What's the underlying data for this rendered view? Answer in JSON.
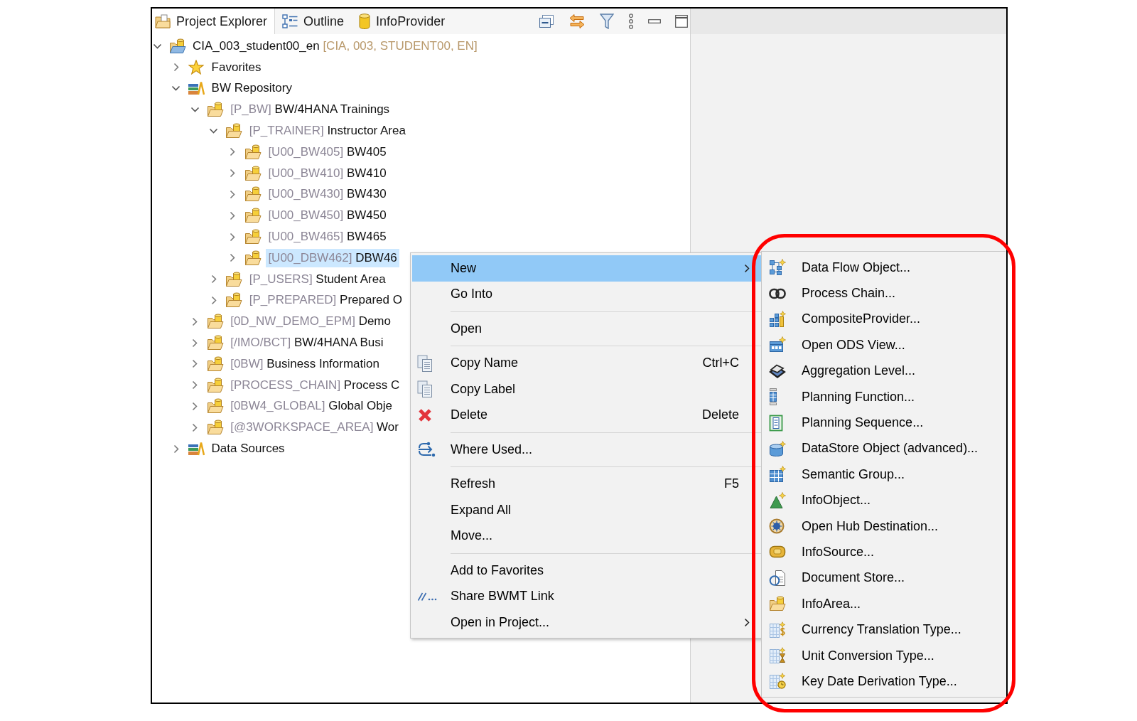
{
  "explorer": {
    "tabs": [
      {
        "kind": "explorer",
        "label": "Project Explorer",
        "selected": true
      },
      {
        "kind": "outline",
        "label": "Outline",
        "selected": false
      },
      {
        "kind": "provider",
        "label": "InfoProvider",
        "selected": false
      }
    ],
    "tree": [
      {
        "kind": "project",
        "name": "CIA_003_student00_en",
        "details": "[CIA, 003, STUDENT00, EN]",
        "expanded": true,
        "selected": false,
        "children": [
          {
            "kind": "favorites",
            "name": "Favorites",
            "expanded": false,
            "selected": false
          },
          {
            "kind": "repository",
            "name": "BW Repository",
            "expanded": true,
            "selected": false,
            "children": [
              {
                "kind": "infoarea",
                "tech_name": "[P_BW]",
                "name": "BW/4HANA Trainings",
                "expanded": true,
                "selected": false,
                "children": [
                  {
                    "kind": "infoarea",
                    "tech_name": "[P_TRAINER]",
                    "name": "Instructor Area",
                    "expanded": true,
                    "selected": false,
                    "children": [
                      {
                        "kind": "infoarea",
                        "tech_name": "[U00_BW405]",
                        "name": "BW405",
                        "expanded": false,
                        "selected": false
                      },
                      {
                        "kind": "infoarea",
                        "tech_name": "[U00_BW410]",
                        "name": "BW410",
                        "expanded": false,
                        "selected": false
                      },
                      {
                        "kind": "infoarea",
                        "tech_name": "[U00_BW430]",
                        "name": "BW430",
                        "expanded": false,
                        "selected": false
                      },
                      {
                        "kind": "infoarea",
                        "tech_name": "[U00_BW450]",
                        "name": "BW450",
                        "expanded": false,
                        "selected": false
                      },
                      {
                        "kind": "infoarea",
                        "tech_name": "[U00_BW465]",
                        "name": "BW465",
                        "expanded": false,
                        "selected": false
                      },
                      {
                        "kind": "infoarea",
                        "tech_name": "[U00_DBW462]",
                        "name": "DBW46",
                        "expanded": false,
                        "selected": true
                      }
                    ]
                  },
                  {
                    "kind": "infoarea",
                    "tech_name": "[P_USERS]",
                    "name": "Student Area",
                    "expanded": false,
                    "selected": false
                  },
                  {
                    "kind": "infoarea",
                    "tech_name": "[P_PREPARED]",
                    "name": "Prepared O",
                    "expanded": false,
                    "selected": false
                  }
                ]
              },
              {
                "kind": "infoarea",
                "tech_name": "[0D_NW_DEMO_EPM]",
                "name": "Demo",
                "expanded": false,
                "selected": false
              },
              {
                "kind": "infoarea",
                "tech_name": "[/IMO/BCT]",
                "name": "BW/4HANA Busi",
                "expanded": false,
                "selected": false
              },
              {
                "kind": "infoarea",
                "tech_name": "[0BW]",
                "name": "Business Information",
                "expanded": false,
                "selected": false
              },
              {
                "kind": "infoarea",
                "tech_name": "[PROCESS_CHAIN]",
                "name": "Process C",
                "expanded": false,
                "selected": false
              },
              {
                "kind": "infoarea",
                "tech_name": "[0BW4_GLOBAL]",
                "name": "Global Obje",
                "expanded": false,
                "selected": false
              },
              {
                "kind": "infoarea",
                "tech_name": "[@3WORKSPACE_AREA]",
                "name": "Wor",
                "expanded": false,
                "selected": false
              }
            ]
          },
          {
            "kind": "repository",
            "name": "Data Sources",
            "expanded": false,
            "selected": false
          }
        ]
      }
    ]
  },
  "context_menu": {
    "groups": [
      {
        "items": [
          {
            "kind": "plain",
            "label": "New",
            "selected": true,
            "submenu": true
          },
          {
            "kind": "plain",
            "label": "Go Into",
            "selected": false
          }
        ]
      },
      {
        "items": [
          {
            "kind": "plain",
            "label": "Open",
            "selected": false
          }
        ]
      },
      {
        "items": [
          {
            "kind": "copy",
            "label": "Copy Name",
            "shortcut": "Ctrl+C",
            "selected": false
          },
          {
            "kind": "copy",
            "label": "Copy Label",
            "selected": false
          },
          {
            "kind": "delete",
            "label": "Delete",
            "shortcut": "Delete",
            "selected": false
          }
        ]
      },
      {
        "items": [
          {
            "kind": "where_used",
            "label": "Where Used...",
            "selected": false
          }
        ]
      },
      {
        "items": [
          {
            "kind": "plain",
            "label": "Refresh",
            "shortcut": "F5",
            "selected": false
          },
          {
            "kind": "plain",
            "label": "Expand All",
            "selected": false
          },
          {
            "kind": "plain",
            "label": "Move...",
            "selected": false
          }
        ]
      },
      {
        "items": [
          {
            "kind": "plain",
            "label": "Add to Favorites",
            "selected": false
          },
          {
            "kind": "share_link",
            "label": "Share BWMT Link",
            "selected": false
          },
          {
            "kind": "plain",
            "label": "Open in Project...",
            "selected": false,
            "submenu": true
          }
        ]
      }
    ]
  },
  "submenu": {
    "highlighted": true,
    "items": [
      {
        "kind": "dataflow",
        "label": "Data Flow Object..."
      },
      {
        "kind": "processchain",
        "label": "Process Chain..."
      },
      {
        "kind": "composite",
        "label": "CompositeProvider..."
      },
      {
        "kind": "odsview",
        "label": "Open ODS View..."
      },
      {
        "kind": "aggregation",
        "label": "Aggregation Level..."
      },
      {
        "kind": "planfunction",
        "label": "Planning Function..."
      },
      {
        "kind": "plansequence",
        "label": "Planning Sequence..."
      },
      {
        "kind": "datastore",
        "label": "DataStore Object (advanced)..."
      },
      {
        "kind": "semantic",
        "label": "Semantic Group..."
      },
      {
        "kind": "infoobject",
        "label": "InfoObject..."
      },
      {
        "kind": "openhub",
        "label": "Open Hub Destination..."
      },
      {
        "kind": "infosource",
        "label": "InfoSource..."
      },
      {
        "kind": "docstore",
        "label": "Document Store..."
      },
      {
        "kind": "infoarea",
        "label": "InfoArea..."
      },
      {
        "kind": "currency",
        "label": "Currency Translation Type..."
      },
      {
        "kind": "unit",
        "label": "Unit Conversion Type..."
      },
      {
        "kind": "keydate",
        "label": "Key Date Derivation Type..."
      }
    ]
  }
}
